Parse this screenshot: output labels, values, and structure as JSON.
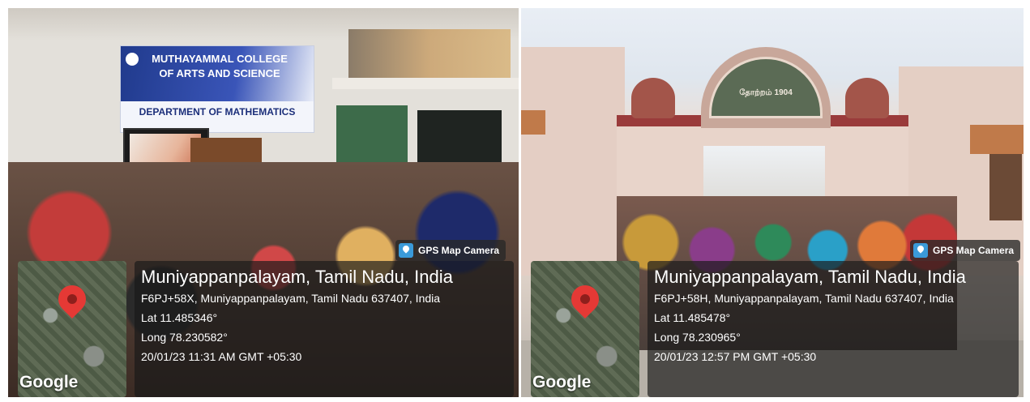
{
  "left_photo": {
    "banner": {
      "college_line1": "MUTHAYAMMAL COLLEGE",
      "college_line2": "OF ARTS AND SCIENCE",
      "department": "DEPARTMENT OF MATHEMATICS"
    },
    "overlay": {
      "badge": "GPS Map Camera",
      "place": "Muniyappanpalayam, Tamil Nadu, India",
      "address": "F6PJ+58X, Muniyappanpalayam, Tamil Nadu 637407, India",
      "lat": "Lat 11.485346°",
      "long": "Long 78.230582°",
      "datetime": "20/01/23 11:31 AM GMT +05:30",
      "map_brand": "Google",
      "icons": [
        "gps-camera-icon",
        "map-pin-icon"
      ]
    }
  },
  "right_photo": {
    "sign": {
      "year": "தோற்றம் 1904"
    },
    "overlay": {
      "badge": "GPS Map Camera",
      "place": "Muniyappanpalayam, Tamil Nadu, India",
      "address": "F6PJ+58H, Muniyappanpalayam, Tamil Nadu 637407, India",
      "lat": "Lat 11.485478°",
      "long": "Long 78.230965°",
      "datetime": "20/01/23 12:57 PM GMT +05:30",
      "map_brand": "Google",
      "icons": [
        "gps-camera-icon",
        "map-pin-icon"
      ]
    }
  },
  "colors": {
    "pin": "#e53935",
    "badge_icon": "#3a9ad9",
    "overlay_bg": "rgba(25,25,25,0.68)"
  }
}
